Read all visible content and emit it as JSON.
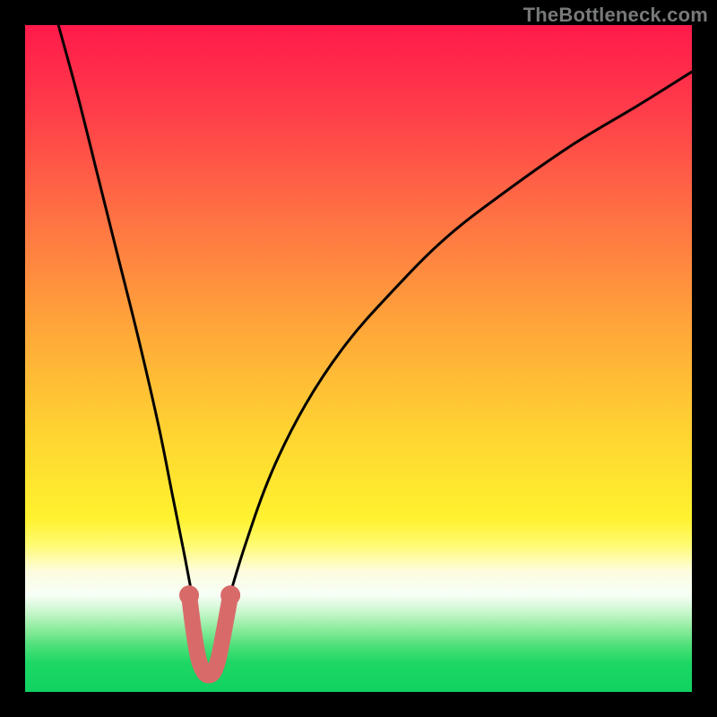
{
  "watermark": "TheBottleneck.com",
  "chart_data": {
    "type": "line",
    "title": "",
    "xlabel": "",
    "ylabel": "",
    "xlim": [
      0,
      100
    ],
    "ylim": [
      0,
      100
    ],
    "series": [
      {
        "name": "bottleneck-curve",
        "x": [
          5,
          8,
          11,
          14,
          17,
          20,
          22,
          24,
          25.5,
          26.5,
          27.5,
          28.5,
          30,
          33,
          37,
          42,
          48,
          55,
          63,
          72,
          82,
          92,
          100
        ],
        "y": [
          100,
          89,
          77,
          65,
          53,
          40,
          30,
          20,
          12,
          6,
          3,
          6,
          12,
          22,
          33,
          43,
          52,
          60,
          68,
          75,
          82,
          88,
          93
        ]
      },
      {
        "name": "highlight-dip",
        "x": [
          24.6,
          25.3,
          26.0,
          26.8,
          27.5,
          28.3,
          29.0,
          29.8,
          30.8
        ],
        "y": [
          14.5,
          9.0,
          5.0,
          3.0,
          2.5,
          3.0,
          5.0,
          9.0,
          14.5
        ]
      }
    ],
    "gradient_stops": [
      {
        "offset": 0.0,
        "color": "#ff1a4b"
      },
      {
        "offset": 0.12,
        "color": "#ff3a4a"
      },
      {
        "offset": 0.28,
        "color": "#ff6f44"
      },
      {
        "offset": 0.45,
        "color": "#ffa53a"
      },
      {
        "offset": 0.62,
        "color": "#ffd631"
      },
      {
        "offset": 0.74,
        "color": "#fff22f"
      },
      {
        "offset": 0.78,
        "color": "#fffb73"
      },
      {
        "offset": 0.82,
        "color": "#fdfce1"
      },
      {
        "offset": 0.855,
        "color": "#f6fef6"
      },
      {
        "offset": 0.88,
        "color": "#c9f7cd"
      },
      {
        "offset": 0.905,
        "color": "#8eec9e"
      },
      {
        "offset": 0.93,
        "color": "#4fe07a"
      },
      {
        "offset": 0.955,
        "color": "#1fd764"
      },
      {
        "offset": 1.0,
        "color": "#0fd261"
      }
    ],
    "colors": {
      "curve": "#000000",
      "highlight": "#d96a6a"
    }
  }
}
